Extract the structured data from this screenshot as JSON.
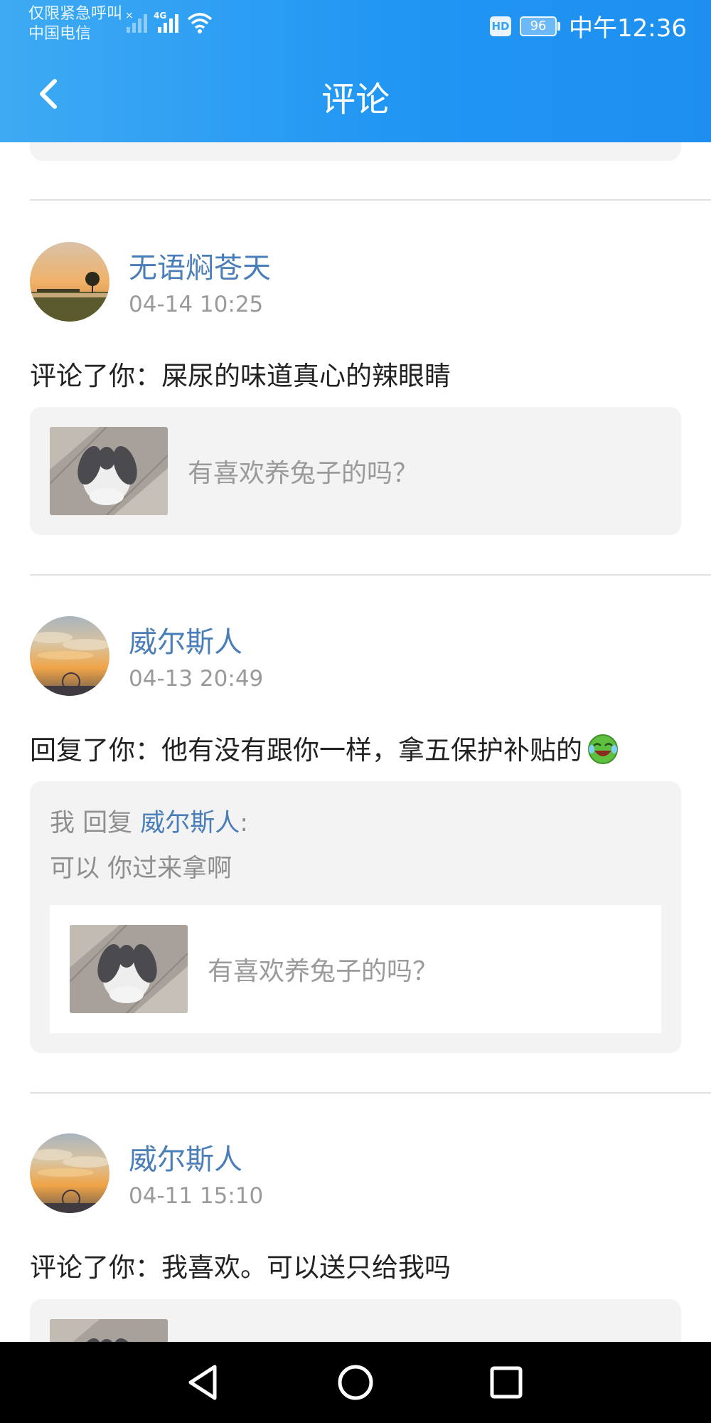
{
  "status_bar": {
    "carrier_line1": "仅限紧急呼叫",
    "carrier_line2": "中国电信",
    "network": "4G",
    "hd_label": "HD",
    "battery": "96",
    "time": "中午12:36"
  },
  "header": {
    "title": "评论"
  },
  "notifications": [
    {
      "username": "无语焖苍天",
      "time": "04-14 10:25",
      "comment": "评论了你：屎尿的味道真心的辣眼睛",
      "post_title": "有喜欢养兔子的吗？"
    },
    {
      "username": "威尔斯人",
      "time": "04-13 20:49",
      "comment": "回复了你：他有没有跟你一样，拿五保护补贴的",
      "reply_prefix": "我  回复 ",
      "reply_to": "威尔斯人",
      "reply_colon": ":",
      "reply_text": "可以 你过来拿啊",
      "post_title": "有喜欢养兔子的吗？"
    },
    {
      "username": "威尔斯人",
      "time": "04-11 15:10",
      "comment": "评论了你：我喜欢。可以送只给我吗"
    }
  ],
  "colors": {
    "header_blue": "#2196f3",
    "username_blue": "#4a7eb8",
    "card_gray": "#f3f3f3"
  },
  "icons": {
    "back": "chevron-left-icon",
    "emoji": "laughing-emoji-icon",
    "nav": [
      "back-triangle-icon",
      "home-circle-icon",
      "recents-square-icon"
    ]
  }
}
